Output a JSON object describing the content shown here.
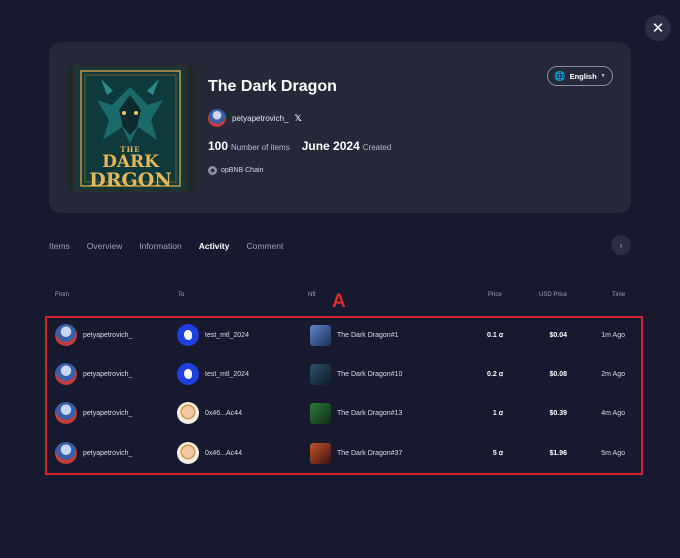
{
  "close_label": "✕",
  "collection": {
    "title": "The Dark Dragon",
    "cover_text": {
      "top": "THE",
      "mid": "DARK",
      "bottom": "DRGON"
    },
    "language": "English",
    "creator": "petyapetrovich_",
    "items_count": "100",
    "items_label": "Number of items",
    "created_date": "June 2024",
    "created_label": "Created",
    "chain": "opBNB Chain"
  },
  "tabs": [
    "Items",
    "Overview",
    "Information",
    "Activity",
    "Comment"
  ],
  "active_tab": "Activity",
  "tab_next": "›",
  "annotation": "A",
  "table": {
    "headers": {
      "from": "From",
      "to": "To",
      "nft": "Nft",
      "price": "Price",
      "usd": "USD Price",
      "time": "Time"
    },
    "rows": [
      {
        "from": "petyapetrovich_",
        "to": "test_mtl_2024",
        "nft": "The Dark Dragon#1",
        "price": "0.1 ꭤ",
        "usd": "$0.04",
        "time": "1m Ago"
      },
      {
        "from": "petyapetrovich_",
        "to": "test_mtl_2024",
        "nft": "The Dark Dragon#10",
        "price": "0.2 ꭤ",
        "usd": "$0.08",
        "time": "2m Ago"
      },
      {
        "from": "petyapetrovich_",
        "to": "0x46...Ac44",
        "nft": "The Dark Dragon#13",
        "price": "1 ꭤ",
        "usd": "$0.39",
        "time": "4m Ago"
      },
      {
        "from": "petyapetrovich_",
        "to": "0x46...Ac44",
        "nft": "The Dark Dragon#37",
        "price": "5 ꭤ",
        "usd": "$1.96",
        "time": "5m Ago"
      }
    ]
  },
  "colors": {
    "background": "#171a2e",
    "card": "#242839",
    "highlight": "#d8222c"
  }
}
